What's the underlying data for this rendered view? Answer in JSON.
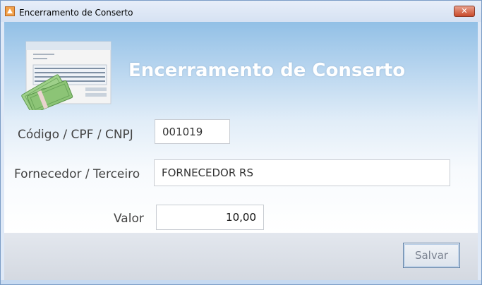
{
  "window": {
    "title": "Encerramento de Conserto",
    "close_label": "✕"
  },
  "header": {
    "title": "Encerramento de Conserto",
    "illustration": "invoice-money-icon"
  },
  "form": {
    "codigo": {
      "label": "Código / CPF / CNPJ",
      "value": "001019"
    },
    "fornecedor": {
      "label": "Fornecedor / Terceiro",
      "value": "FORNECEDOR RS"
    },
    "valor": {
      "label": "Valor",
      "value": "10,00"
    }
  },
  "actions": {
    "save_label": "Salvar"
  }
}
